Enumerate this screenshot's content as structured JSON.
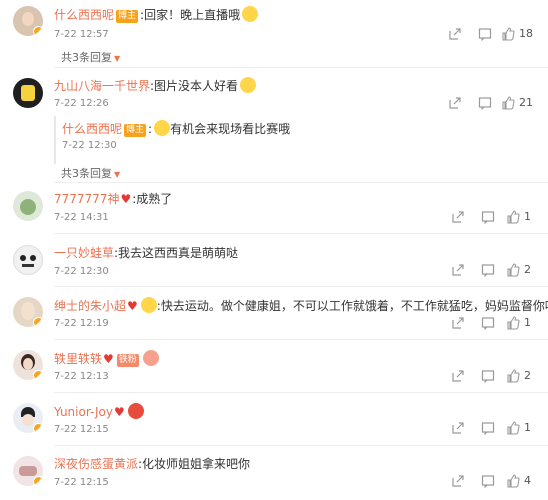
{
  "comments": [
    {
      "user": "什么西西呢",
      "badge": "博主",
      "text": ":回家！晚上直播哦",
      "time": "7-22 12:57",
      "likes": "18",
      "more": "共3条回复"
    },
    {
      "user": "九山八海一千世界",
      "text": ":图片没本人好看",
      "time": "7-22 12:26",
      "likes": "21",
      "more": "共3条回复",
      "reply": {
        "user": "什么西西呢",
        "badge": "博主",
        "text": "有机会来现场看比赛哦",
        "time": "7-22 12:30"
      }
    },
    {
      "user": "7777777神",
      "text": ":成熟了",
      "time": "7-22 14:31",
      "likes": "1"
    },
    {
      "user": "一只妙蛙草",
      "text": ":我去这西西真是萌萌哒",
      "time": "7-22 12:30",
      "likes": "2"
    },
    {
      "user": "绅士的朱小超",
      "text": ":快去运动。做个健康姐，不可以工作就饿着，不工作就猛吃，妈妈监督你呢",
      "time": "7-22 12:19",
      "likes": "1"
    },
    {
      "user": "轶里轶轶",
      "badge": "铁粉",
      "text": "",
      "time": "7-22 12:13",
      "likes": "2"
    },
    {
      "user": "Yunior-Joy",
      "text": "",
      "time": "7-22 12:15",
      "likes": "1"
    },
    {
      "user": "深夜伤感蛋黄派",
      "text": ":化妆师姐姐拿来吧你",
      "time": "7-22 12:15",
      "likes": "4"
    }
  ],
  "colors": {
    "username": "#eb7350",
    "badge": "#f7a21b"
  }
}
